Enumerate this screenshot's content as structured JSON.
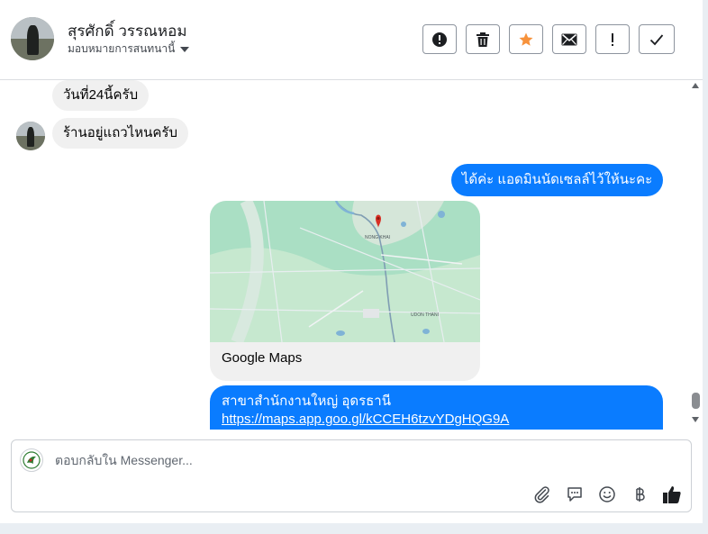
{
  "header": {
    "contact_name": "สุรศักดิ์ วรรณหอม",
    "assign_label": "มอบหมายการสนทนานี้",
    "toolbar": [
      {
        "name": "spam-button",
        "icon": "alert-circle-icon"
      },
      {
        "name": "delete-button",
        "icon": "trash-icon"
      },
      {
        "name": "star-button",
        "icon": "star-icon",
        "color": "#f7923b"
      },
      {
        "name": "mark-unread-button",
        "icon": "envelope-icon"
      },
      {
        "name": "follow-up-button",
        "icon": "exclamation-icon"
      },
      {
        "name": "mark-done-button",
        "icon": "checkmark-icon"
      }
    ]
  },
  "conversation": {
    "messages": [
      {
        "direction": "incoming",
        "text": "วันที่24นี้ครับ"
      },
      {
        "direction": "incoming",
        "text": "ร้านอยู่แถวไหนครับ"
      },
      {
        "direction": "outgoing",
        "text": "ได้ค่ะ แอดมินนัดเซลล์ไว้ให้นะคะ"
      },
      {
        "direction": "outgoing",
        "type": "link-preview",
        "title": "Google Maps",
        "map_labels": {
          "city_top": "NONG KHAI",
          "city_bottom": "UDON THANI"
        }
      },
      {
        "direction": "outgoing",
        "text": "สาขาสำนักงานใหญ่ อุดรธานี",
        "link": "https://maps.app.goo.gl/kCCEH6tzvYDgHQG9A"
      }
    ]
  },
  "composer": {
    "placeholder": "ตอบกลับใน Messenger...",
    "icons": [
      "paperclip-icon",
      "saved-replies-icon",
      "emoji-icon",
      "baht-payment-icon",
      "like-icon"
    ]
  },
  "colors": {
    "outgoing_bubble": "#0a7cff",
    "incoming_bubble": "#f0f0f0",
    "star": "#f7923b"
  }
}
